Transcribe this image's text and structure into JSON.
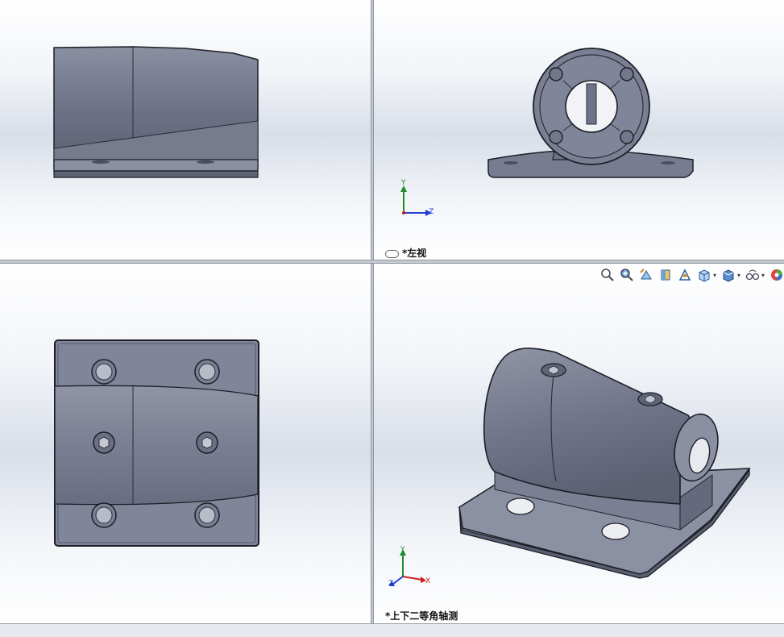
{
  "viewports": {
    "front": {},
    "left": {
      "label": "*左视",
      "triad": {
        "x": "",
        "y": "Y",
        "z": "Z"
      }
    },
    "top": {},
    "iso": {
      "label": "*上下二等角轴测",
      "triad": {
        "x": "X",
        "y": "Y",
        "z": "Z"
      }
    }
  },
  "toolbar": {
    "buttons": [
      {
        "name": "zoom-to-fit-icon"
      },
      {
        "name": "zoom-to-area-icon"
      },
      {
        "name": "previous-view-icon"
      },
      {
        "name": "section-view-icon"
      },
      {
        "name": "dynamic-annotation-icon"
      },
      {
        "name": "view-orientation-icon",
        "dropdown": true
      },
      {
        "name": "display-style-icon",
        "dropdown": true
      },
      {
        "name": "hide-show-items-icon",
        "dropdown": true
      },
      {
        "name": "appearance-icon"
      }
    ]
  },
  "colors": {
    "part": "#7a7f93",
    "part_dark": "#5d6275",
    "edge": "#1c1e26",
    "triad_x": "#d01c1c",
    "triad_y": "#1e8a2a",
    "triad_z": "#1c3fcf"
  }
}
